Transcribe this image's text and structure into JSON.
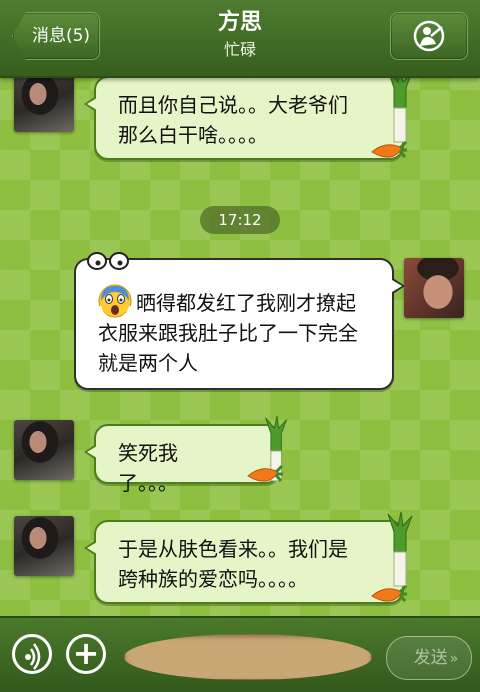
{
  "header": {
    "back_label": "消息(5)",
    "contact_name": "方思",
    "contact_status": "忙碌",
    "profile_icon": "person-icon"
  },
  "messages": [
    {
      "side": "received",
      "text": "而且你自己说。。大老爷们那么白干啥。。。。"
    },
    {
      "type": "timestamp",
      "text": "17:12"
    },
    {
      "side": "sent",
      "emoji": "screaming-face-emoji",
      "text": "晒得都发红了我刚才撩起衣服来跟我肚子比了一下完全就是两个人"
    },
    {
      "side": "received",
      "text": "笑死我了。。。"
    },
    {
      "side": "received",
      "text": "于是从肤色看来。。我们是跨种族的爱恋吗。。。。"
    }
  ],
  "input_bar": {
    "voice_icon": "voice-icon",
    "plus_icon": "plus-icon",
    "send_label": "发送",
    "send_chevron": "»"
  },
  "colors": {
    "header": "#3f6a25",
    "background": "#8fbf40",
    "received_bubble": "#e6f5c7",
    "sent_bubble": "#ffffff",
    "input_field": "#c9a774"
  }
}
